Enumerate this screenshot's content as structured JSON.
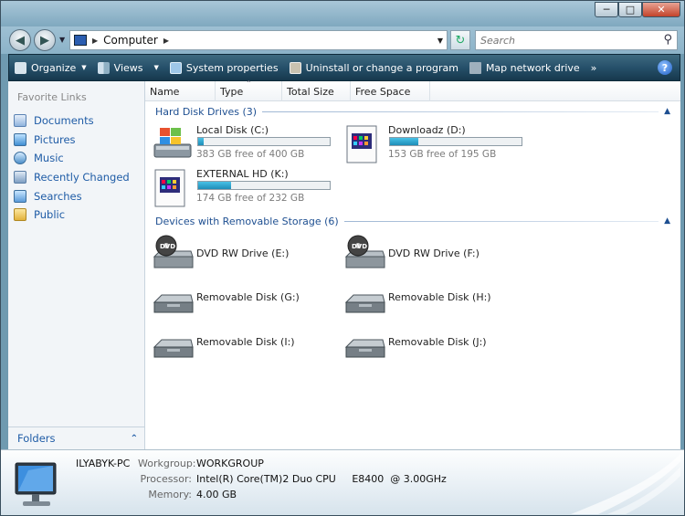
{
  "addressbar": {
    "path": "Computer",
    "search_placeholder": "Search"
  },
  "toolbar": {
    "organize": "Organize",
    "views": "Views",
    "system_properties": "System properties",
    "uninstall": "Uninstall or change a program",
    "map_drive": "Map network drive",
    "more": "»",
    "help": "?"
  },
  "sidebar": {
    "title": "Favorite Links",
    "items": [
      {
        "label": "Documents",
        "icon": "documents-icon"
      },
      {
        "label": "Pictures",
        "icon": "pictures-icon"
      },
      {
        "label": "Music",
        "icon": "music-icon"
      },
      {
        "label": "Recently Changed",
        "icon": "recently-changed-icon"
      },
      {
        "label": "Searches",
        "icon": "searches-icon"
      },
      {
        "label": "Public",
        "icon": "public-folder-icon"
      }
    ],
    "folders": "Folders"
  },
  "columns": [
    "Name",
    "Type",
    "Total Size",
    "Free Space"
  ],
  "groups": {
    "hard_disks": "Hard Disk Drives (3)",
    "removable": "Devices with Removable Storage (6)"
  },
  "hard_disks": [
    {
      "name": "Local Disk (C:)",
      "free": "383 GB free of 400 GB",
      "used_fraction": 0.0425,
      "icon": "windows-drive-icon"
    },
    {
      "name": "Downloadz (D:)",
      "free": "153 GB free of 195 GB",
      "used_fraction": 0.215,
      "icon": "drive-icon"
    },
    {
      "name": "EXTERNAL HD (K:)",
      "free": "174 GB free of 232 GB",
      "used_fraction": 0.25,
      "icon": "drive-icon"
    }
  ],
  "removable": [
    {
      "name": "DVD RW Drive (E:)",
      "icon": "dvd-drive-icon"
    },
    {
      "name": "DVD RW Drive (F:)",
      "icon": "dvd-drive-icon"
    },
    {
      "name": "Removable Disk (G:)",
      "icon": "removable-disk-icon"
    },
    {
      "name": "Removable Disk (H:)",
      "icon": "removable-disk-icon"
    },
    {
      "name": "Removable Disk (I:)",
      "icon": "removable-disk-icon"
    },
    {
      "name": "Removable Disk (J:)",
      "icon": "removable-disk-icon"
    }
  ],
  "details": {
    "computer_name": "ILYABYK-PC",
    "workgroup_label": "Workgroup:",
    "workgroup": "WORKGROUP",
    "processor_label": "Processor:",
    "processor": "Intel(R) Core(TM)2 Duo CPU     E8400  @ 3.00GHz",
    "memory_label": "Memory:",
    "memory": "4.00 GB"
  },
  "colors": {
    "toolbar": "#26506a",
    "link": "#1f5ca6",
    "group_title": "#1e4f91",
    "bar_fill": "#1e8db8"
  }
}
